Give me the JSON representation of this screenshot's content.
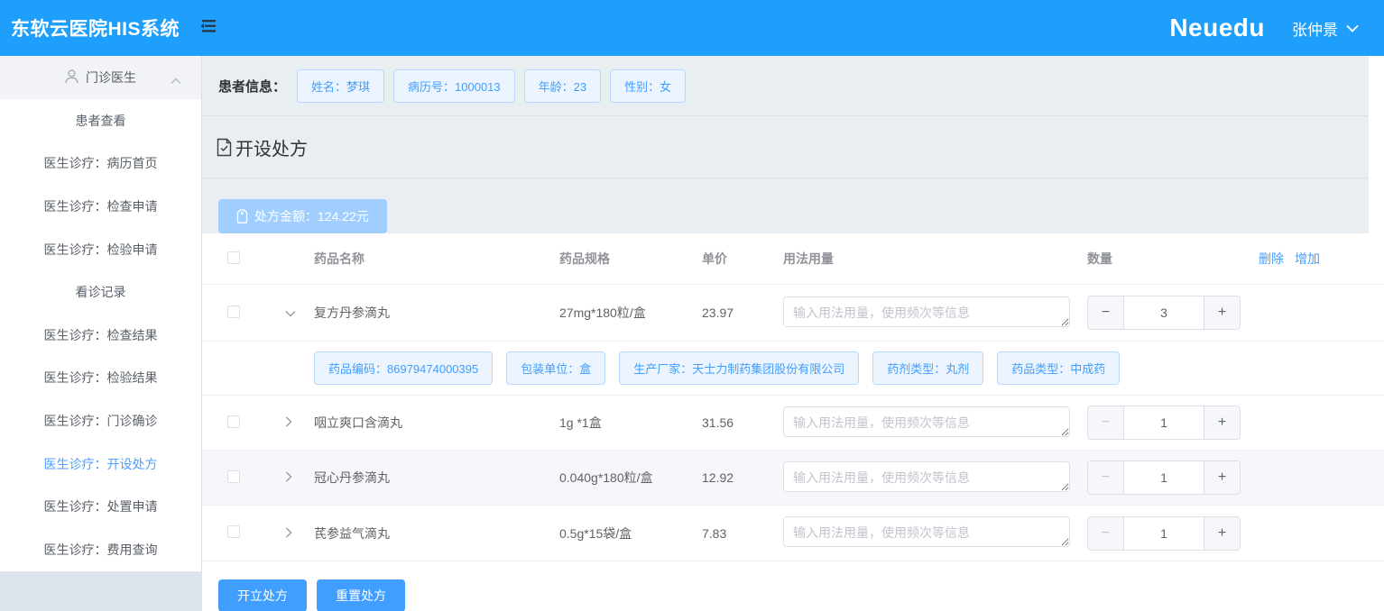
{
  "header": {
    "app_title": "东软云医院HIS系统",
    "brand": "Neuedu",
    "user_name": "张仲景"
  },
  "sidebar": {
    "group_label": "门诊医生",
    "items": [
      {
        "label": "患者查看",
        "active": false
      },
      {
        "label": "医生诊疗：病历首页",
        "active": false
      },
      {
        "label": "医生诊疗：检查申请",
        "active": false
      },
      {
        "label": "医生诊疗：检验申请",
        "active": false
      },
      {
        "label": "看诊记录",
        "active": false
      },
      {
        "label": "医生诊疗：检查结果",
        "active": false
      },
      {
        "label": "医生诊疗：检验结果",
        "active": false
      },
      {
        "label": "医生诊疗：门诊确诊",
        "active": false
      },
      {
        "label": "医生诊疗：开设处方",
        "active": true
      },
      {
        "label": "医生诊疗：处置申请",
        "active": false
      },
      {
        "label": "医生诊疗：费用查询",
        "active": false
      }
    ]
  },
  "patient_bar": {
    "label": "患者信息：",
    "badges": {
      "name": "姓名：梦琪",
      "record_no": "病历号：1000013",
      "age": "年龄：23",
      "gender": "性别：女"
    }
  },
  "prescription": {
    "section_title": "开设处方",
    "amount_label": "处方金额：124.22元",
    "table": {
      "columns": {
        "name": "药品名称",
        "spec": "药品规格",
        "price": "单价",
        "usage": "用法用量",
        "qty": "数量"
      },
      "actions": {
        "delete": "删除",
        "add": "增加"
      },
      "usage_placeholder": "输入用法用量，使用频次等信息",
      "rows": [
        {
          "name": "复方丹参滴丸",
          "spec": "27mg*180粒/盒",
          "price": "23.97",
          "qty": "3",
          "expanded": true,
          "details": [
            "药品编码：86979474000395",
            "包装单位：盒",
            "生产厂家：天士力制药集团股份有限公司",
            "药剂类型：丸剂",
            "药品类型：中成药"
          ]
        },
        {
          "name": "咽立爽口含滴丸",
          "spec": "1g *1盒",
          "price": "31.56",
          "qty": "1",
          "expanded": false
        },
        {
          "name": "冠心丹参滴丸",
          "spec": "0.040g*180粒/盒",
          "price": "12.92",
          "qty": "1",
          "expanded": false
        },
        {
          "name": "芪参益气滴丸",
          "spec": "0.5g*15袋/盒",
          "price": "7.83",
          "qty": "1",
          "expanded": false
        }
      ]
    },
    "footer_actions": {
      "submit": "开立处方",
      "reset": "重置处方"
    }
  },
  "icons": {
    "menu_fold": "menu-fold-icon",
    "user": "user-icon",
    "chevron_up": "chevron-up-icon",
    "chevron_down": "chevron-down-icon",
    "chevron_right": "chevron-right-icon",
    "document": "document-icon",
    "price_tag": "price-tag-icon"
  },
  "colors": {
    "topbar_bg": "#1f9ffc",
    "primary": "#409eff",
    "amount_button_bg": "#a0cfff",
    "badge_bg": "#ecf5ff",
    "badge_border": "#b6daff",
    "active_menu_text": "#4e9fff",
    "row_highlight_bg": "#f5f7fa"
  }
}
